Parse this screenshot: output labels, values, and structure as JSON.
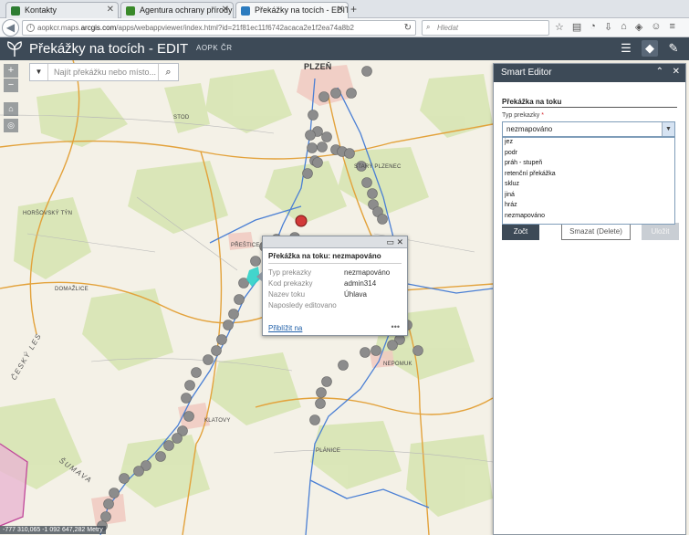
{
  "browser": {
    "tabs": [
      {
        "label": "Kontakty",
        "active": false,
        "favicon_color": "#2e7d32"
      },
      {
        "label": "Agentura ochrany přírody ...",
        "active": false,
        "favicon_color": "#3a8a2a"
      },
      {
        "label": "Překážky na tocích - EDIT",
        "active": true,
        "favicon_color": "#2b7bbf"
      }
    ],
    "new_tab": "+",
    "url_prefix": "aopkcr.maps.",
    "url_domain": "arcgis.com",
    "url_suffix": "/apps/webappviewer/index.html?id=21f81ec11f6742acaca2e1f2ea74a8b2",
    "search_placeholder": "Hledat"
  },
  "app": {
    "title": "Překážky na tocích - EDIT",
    "subtitle": "AOPK ČR"
  },
  "map": {
    "search_placeholder": "Najít překážku nebo místo...",
    "coords": "-777 310,065 -1 092 647,282 Metry",
    "labels": {
      "plzen": "PLZEŇ",
      "domazlice": "DOMAŽLICE",
      "klatovy": "KLATOVY",
      "horsovsky": "HORŠOVSKÝ TÝN",
      "nepomuk": "NEPOMUK",
      "planice": "PLÁNICE",
      "prestice": "PŘEŠTICE",
      "stod": "STOD",
      "stary_plzenec": "STARÝ PLZENEC",
      "sumava": "ŠUMAVA",
      "cesky_les": "ČESKÝ LES"
    },
    "obstacle_colors": {
      "normal": "#8c8c8c",
      "selected": "#d23a3a",
      "highlight": "#2fd1c9"
    }
  },
  "popup": {
    "title": "Překážka na toku: nezmapováno",
    "fields": [
      {
        "key": "Typ prekazky",
        "value": "nezmapováno"
      },
      {
        "key": "Kod prekazky",
        "value": "admin314"
      },
      {
        "key": "Nazev toku",
        "value": "Úhlava"
      },
      {
        "key": "Naposledy editovano",
        "value": ""
      }
    ],
    "zoom_link": "Přiblížit na",
    "more": "•••"
  },
  "editor": {
    "title": "Smart Editor",
    "section": "Překážka na toku",
    "field_label": "Typ prekazky",
    "required_mark": "*",
    "selected_value": "nezmapováno",
    "options": [
      "jez",
      "podr",
      "práh - stupeň",
      "retenční překážka",
      "skluz",
      "jiná",
      "hráz",
      "nezmapováno"
    ],
    "buttons": {
      "close": "Zočt",
      "delete": "Smazat (Delete)",
      "save": "Uložit"
    }
  }
}
